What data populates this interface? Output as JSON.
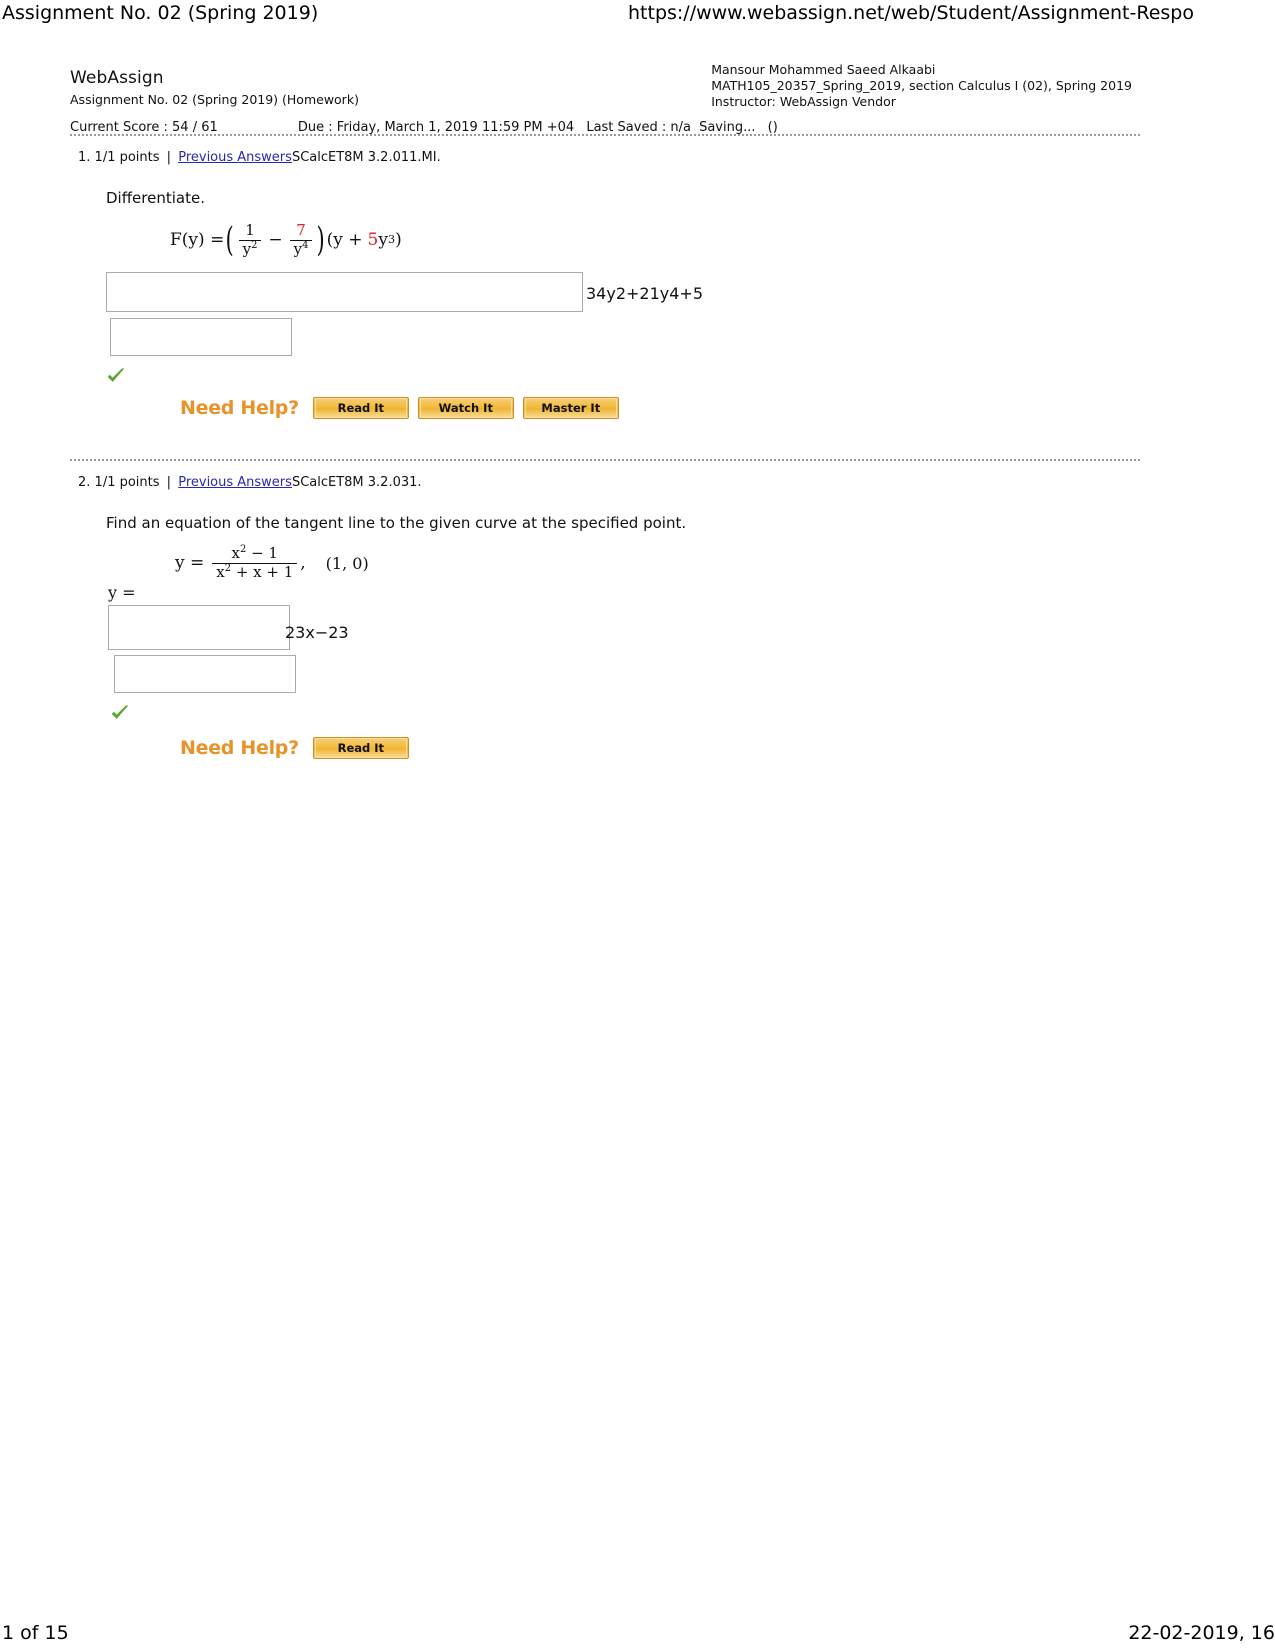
{
  "print_header": {
    "title": "Assignment No. 02 (Spring 2019)",
    "url": "https://www.webassign.net/web/Student/Assignment-Respo"
  },
  "print_footer": {
    "page": "1 of 15",
    "date": "22-02-2019, 16"
  },
  "assignment": {
    "product": "WebAssign",
    "subtitle": "Assignment No. 02 (Spring 2019) (Homework)",
    "current_score_label": "Current Score : 54 / 61",
    "due_label": "Due : Friday, March 1, 2019 11:59 PM +04",
    "last_saved_label": "Last Saved : n/a",
    "saving_label": "Saving...",
    "saving_paren": "()"
  },
  "student": {
    "name": "Mansour Mohammed Saeed Alkaabi",
    "course": "MATH105_20357_Spring_2019, section Calculus I (02), Spring 2019",
    "instructor": "Instructor: WebAssign Vendor"
  },
  "questions": [
    {
      "number": "1.",
      "points": "1/1 points",
      "pipe": "|",
      "previous_answers": "Previous Answers",
      "code": "SCalcET8M 3.2.011.MI.",
      "prompt": "Differentiate.",
      "formula": {
        "lhs": "F(y) =",
        "frac1_num": "1",
        "frac1_den_base": "y",
        "frac1_den_exp": "2",
        "minus": "−",
        "frac2_num": "7",
        "frac2_den_base": "y",
        "frac2_den_exp": "4",
        "tail_open": "(y +",
        "tail_coef": "5",
        "tail_var": "y",
        "tail_exp": "3",
        "tail_close": ")"
      },
      "answer_box_1_value": "",
      "answer_tail_text": "34y2+21y4+5",
      "answer_box_2_value": "",
      "status_icon": "green-check-icon",
      "need_help_label": "Need Help?",
      "help_buttons": [
        "Read It",
        "Watch It",
        "Master It"
      ]
    },
    {
      "number": "2.",
      "points": "1/1 points",
      "pipe": "|",
      "previous_answers": "Previous Answers",
      "code": "SCalcET8M 3.2.031.",
      "prompt": "Find an equation of the tangent line to the given curve at the specified point.",
      "formula": {
        "lhs": "y =",
        "num_base": "x",
        "num_exp": "2",
        "num_rest": "− 1",
        "den_base": "x",
        "den_exp": "2",
        "den_rest": "+ x + 1",
        "comma": ",",
        "point": "(1, 0)"
      },
      "answer_prefix": "y =",
      "answer_box_1_value": "",
      "answer_tail_text": "23x−23",
      "answer_box_2_value": "",
      "status_icon": "green-check-icon",
      "need_help_label": "Need Help?",
      "help_buttons": [
        "Read It"
      ]
    }
  ],
  "colors": {
    "link": "#2727b0",
    "red_accent": "#e02020",
    "need_help_orange": "#e8922a",
    "check_green": "#5aa832"
  }
}
